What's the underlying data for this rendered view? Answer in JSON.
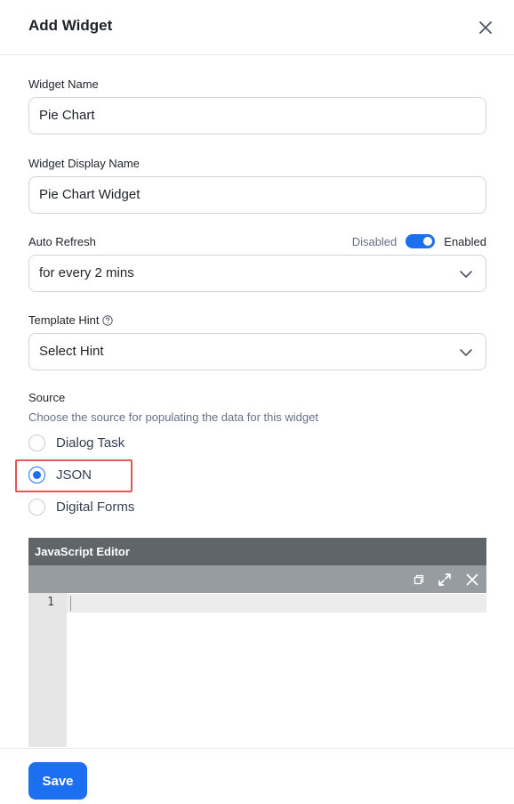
{
  "dialog": {
    "title": "Add Widget"
  },
  "widget_name": {
    "label": "Widget Name",
    "value": "Pie Chart"
  },
  "widget_display_name": {
    "label": "Widget Display Name",
    "value": "Pie Chart Widget"
  },
  "auto_refresh": {
    "label": "Auto Refresh",
    "toggle_off_label": "Disabled",
    "toggle_on_label": "Enabled",
    "enabled": true,
    "selected": "for every 2 mins"
  },
  "template_hint": {
    "label": "Template Hint",
    "selected": "Select Hint"
  },
  "source": {
    "label": "Source",
    "description": "Choose the source for populating the data for this widget",
    "options": [
      "Dialog Task",
      "JSON",
      "Digital Forms"
    ],
    "selected": "JSON"
  },
  "editor": {
    "title": "JavaScript Editor",
    "line_numbers": [
      "1"
    ]
  },
  "footer": {
    "save_label": "Save"
  },
  "colors": {
    "accent": "#1d6ff2",
    "highlight": "#e45757",
    "editor_header": "#606569",
    "editor_toolbar": "#979ca0"
  }
}
